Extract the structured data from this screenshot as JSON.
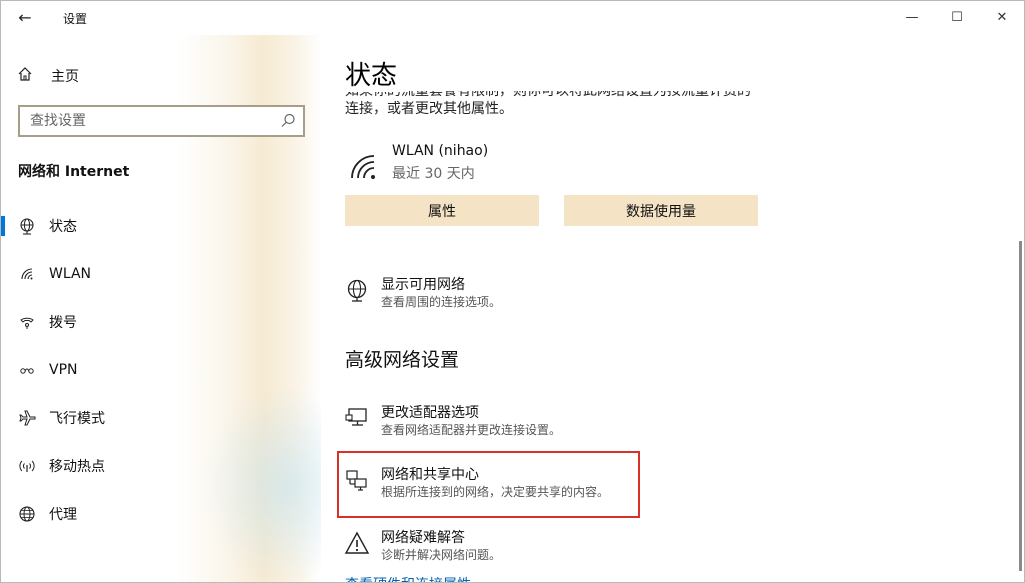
{
  "titlebar": {
    "back": "←",
    "title": "设置",
    "minimize": "—",
    "maximize": "☐",
    "close": "✕"
  },
  "sidebar": {
    "home_label": "主页",
    "search_placeholder": "查找设置",
    "section_title": "网络和 Internet",
    "items": [
      {
        "label": "状态",
        "icon": "globe-status-icon",
        "active": true
      },
      {
        "label": "WLAN",
        "icon": "wifi-icon"
      },
      {
        "label": "拨号",
        "icon": "dialup-icon"
      },
      {
        "label": "VPN",
        "icon": "vpn-icon"
      },
      {
        "label": "飞行模式",
        "icon": "airplane-icon"
      },
      {
        "label": "移动热点",
        "icon": "hotspot-icon"
      },
      {
        "label": "代理",
        "icon": "globe-icon"
      }
    ]
  },
  "main": {
    "page_title": "状态",
    "intro_line1": "如果你的流量套餐有限制，则你可以将此网络设置为按流量计费的",
    "intro_line2": "连接，或者更改其他属性。",
    "connection": {
      "name": "WLAN (nihao)",
      "sub": "最近 30 天内"
    },
    "buttons": {
      "properties": "属性",
      "data_usage": "数据使用量"
    },
    "show_networks": {
      "title": "显示可用网络",
      "desc": "查看周围的连接选项。"
    },
    "advanced_heading": "高级网络设置",
    "adapter": {
      "title": "更改适配器选项",
      "desc": "查看网络适配器并更改连接设置。"
    },
    "sharing": {
      "title": "网络和共享中心",
      "desc": "根据所连接到的网络，决定要共享的内容。"
    },
    "troubleshoot": {
      "title": "网络疑难解答",
      "desc": "诊断并解决网络问题。"
    },
    "bottom_link": "查看硬件和连接属性"
  },
  "colors": {
    "accent": "#0078d7",
    "button_bg": "#f5e3c6",
    "highlight": "#d9302a"
  }
}
